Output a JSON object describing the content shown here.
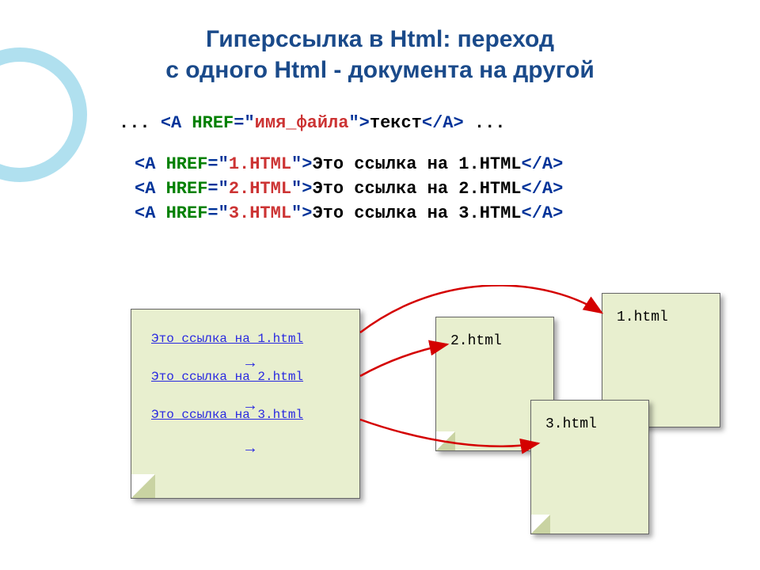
{
  "title_line1": "Гиперссылка  в Html:  переход",
  "title_line2": "с одного Html - документа на другой",
  "syntax": {
    "prefix": "...",
    "open_a": "<A ",
    "href": "HREF",
    "eq": "=",
    "q1": "\"",
    "filename": "имя_файла",
    "q2": "\"",
    "close_open": ">",
    "linktext": "текст",
    "close_a": "</A>",
    "suffix": " ..."
  },
  "examples": [
    {
      "file": "1.HTML",
      "text": "Это ссылка на 1.HTML"
    },
    {
      "file": "2.HTML",
      "text": "Это ссылка на 2.HTML"
    },
    {
      "file": "3.HTML",
      "text": "Это ссылка на 3.HTML"
    }
  ],
  "main_links": [
    "Это ссылка на 1.html",
    "Это ссылка на 2.html",
    "Это ссылка на 3.html"
  ],
  "docs": {
    "d1": "1.html",
    "d2": "2.html",
    "d3": "3.html"
  }
}
